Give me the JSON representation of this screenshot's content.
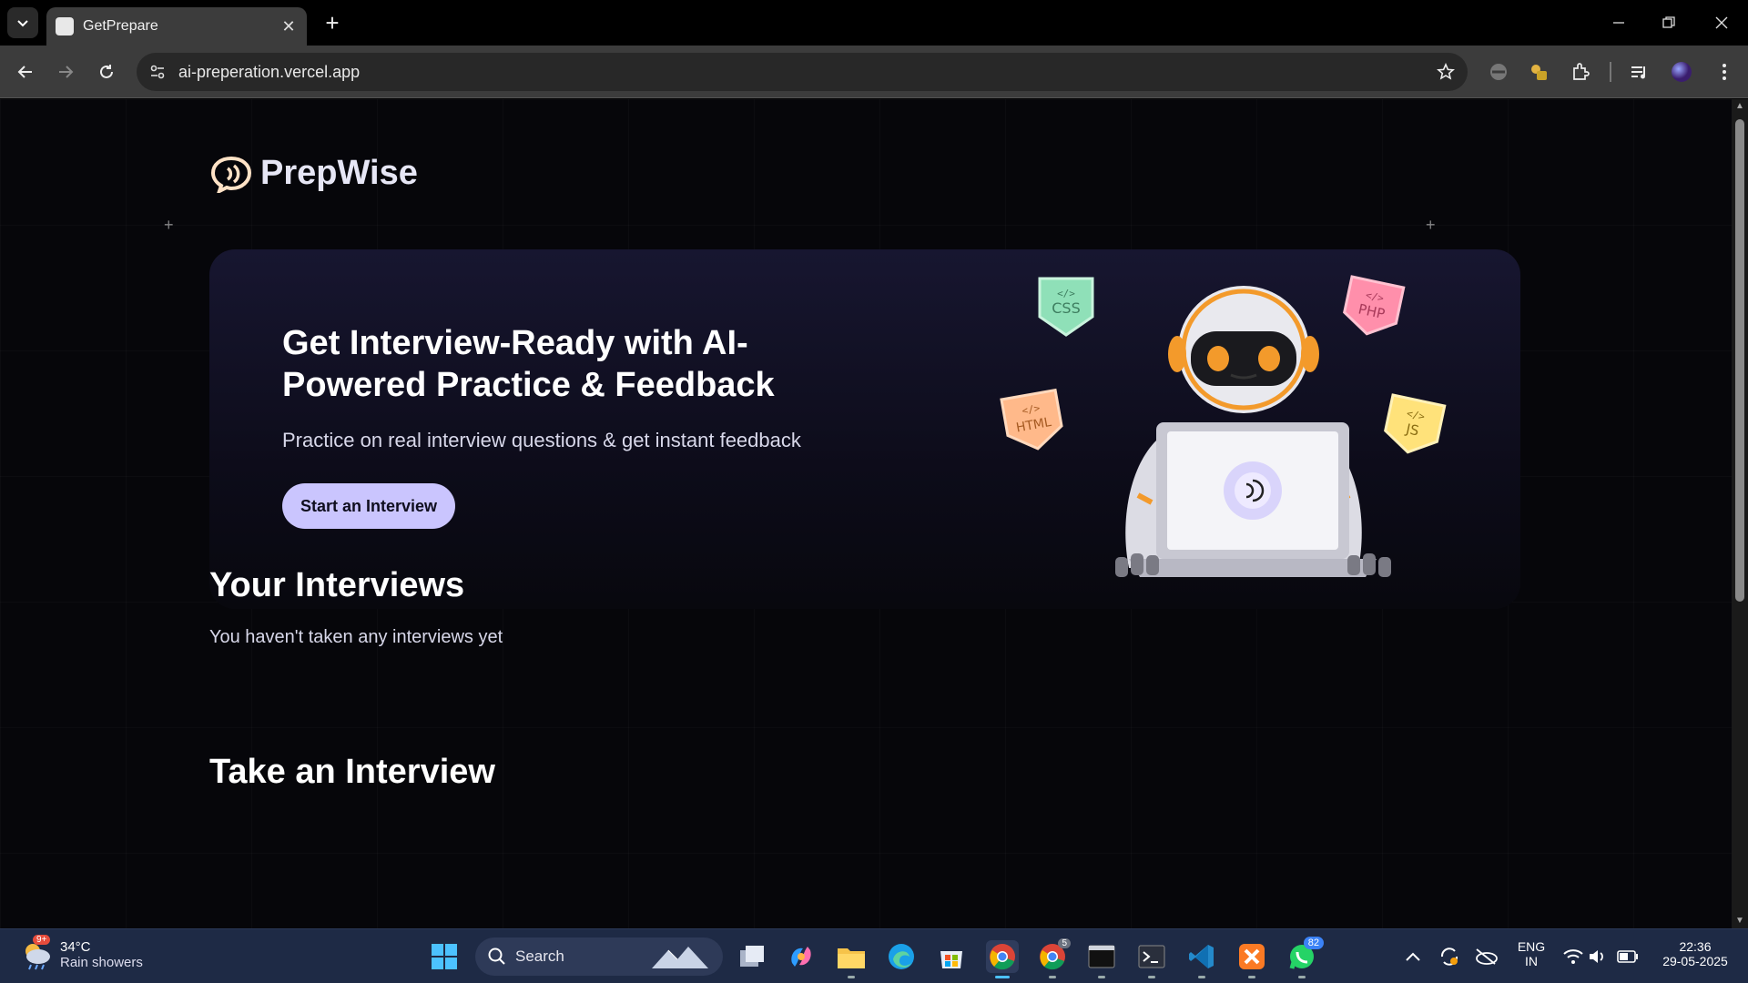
{
  "browser": {
    "tab_title": "GetPrepare",
    "url": "ai-preperation.vercel.app"
  },
  "app": {
    "logo_text": "PrepWise",
    "hero": {
      "heading": "Get Interview-Ready with AI-Powered Practice & Feedback",
      "subheading": "Practice on real interview questions & get instant feedback",
      "cta_label": "Start an Interview",
      "badges": [
        "CSS",
        "PHP",
        "HTML",
        "JS"
      ]
    },
    "your_interviews": {
      "title": "Your Interviews",
      "empty_message": "You haven't taken any interviews yet"
    },
    "take_interview": {
      "title": "Take an Interview"
    }
  },
  "taskbar": {
    "weather_temp": "34°C",
    "weather_desc": "Rain showers",
    "weather_badge": "9+",
    "search_label": "Search",
    "chrome_badge": "5",
    "whatsapp_badge": "82",
    "lang_line1": "ENG",
    "lang_line2": "IN",
    "time": "22:36",
    "date": "29-05-2025"
  },
  "colors": {
    "accent": "#cac5fe",
    "hero_bg_top": "#171630",
    "page_bg": "#06060a",
    "taskbar_bg": "#1e2a45"
  }
}
